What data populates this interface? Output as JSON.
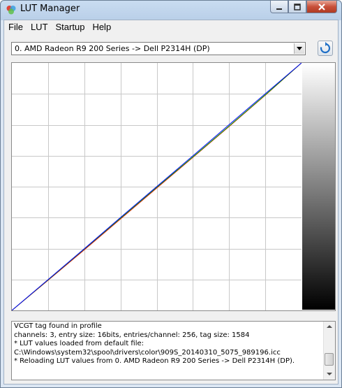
{
  "window": {
    "title": "LUT Manager",
    "icon": "color-wheel-icon",
    "controls": {
      "minimize": "minimize-icon",
      "maximize": "maximize-icon",
      "close": "close-icon"
    }
  },
  "menu": {
    "items": [
      "File",
      "LUT",
      "Startup",
      "Help"
    ]
  },
  "display_select": {
    "value": "0. AMD Radeon R9 200 Series -> Dell P2314H (DP)"
  },
  "refresh": {
    "icon": "refresh-icon"
  },
  "chart_data": {
    "type": "line",
    "xlim": [
      0,
      255
    ],
    "ylim": [
      0,
      65535
    ],
    "grid": true,
    "series": [
      {
        "color": "#ff0000",
        "x": [
          0,
          32,
          64,
          96,
          128,
          160,
          192,
          224,
          255
        ],
        "y": [
          0,
          8000,
          16100,
          24300,
          32500,
          40700,
          48900,
          57200,
          65535
        ]
      },
      {
        "color": "#00b000",
        "x": [
          0,
          32,
          64,
          96,
          128,
          160,
          192,
          224,
          255
        ],
        "y": [
          0,
          8100,
          16300,
          24500,
          32700,
          40800,
          49000,
          57300,
          65535
        ]
      },
      {
        "color": "#0000ff",
        "x": [
          0,
          32,
          64,
          96,
          128,
          160,
          192,
          224,
          255
        ],
        "y": [
          0,
          8200,
          16400,
          24700,
          32900,
          41100,
          49400,
          57600,
          65535
        ]
      }
    ]
  },
  "log": {
    "lines": [
      "VCGT tag found in profile",
      "channels: 3, entry size: 16bits, entries/channel: 256, tag size: 1584",
      "* LUT values loaded from default file:",
      "  C:\\Windows\\system32\\spool\\drivers\\color\\909S_20140310_5075_989196.icc",
      "* Reloading LUT values from 0. AMD Radeon R9 200 Series -> Dell P2314H (DP)."
    ]
  }
}
